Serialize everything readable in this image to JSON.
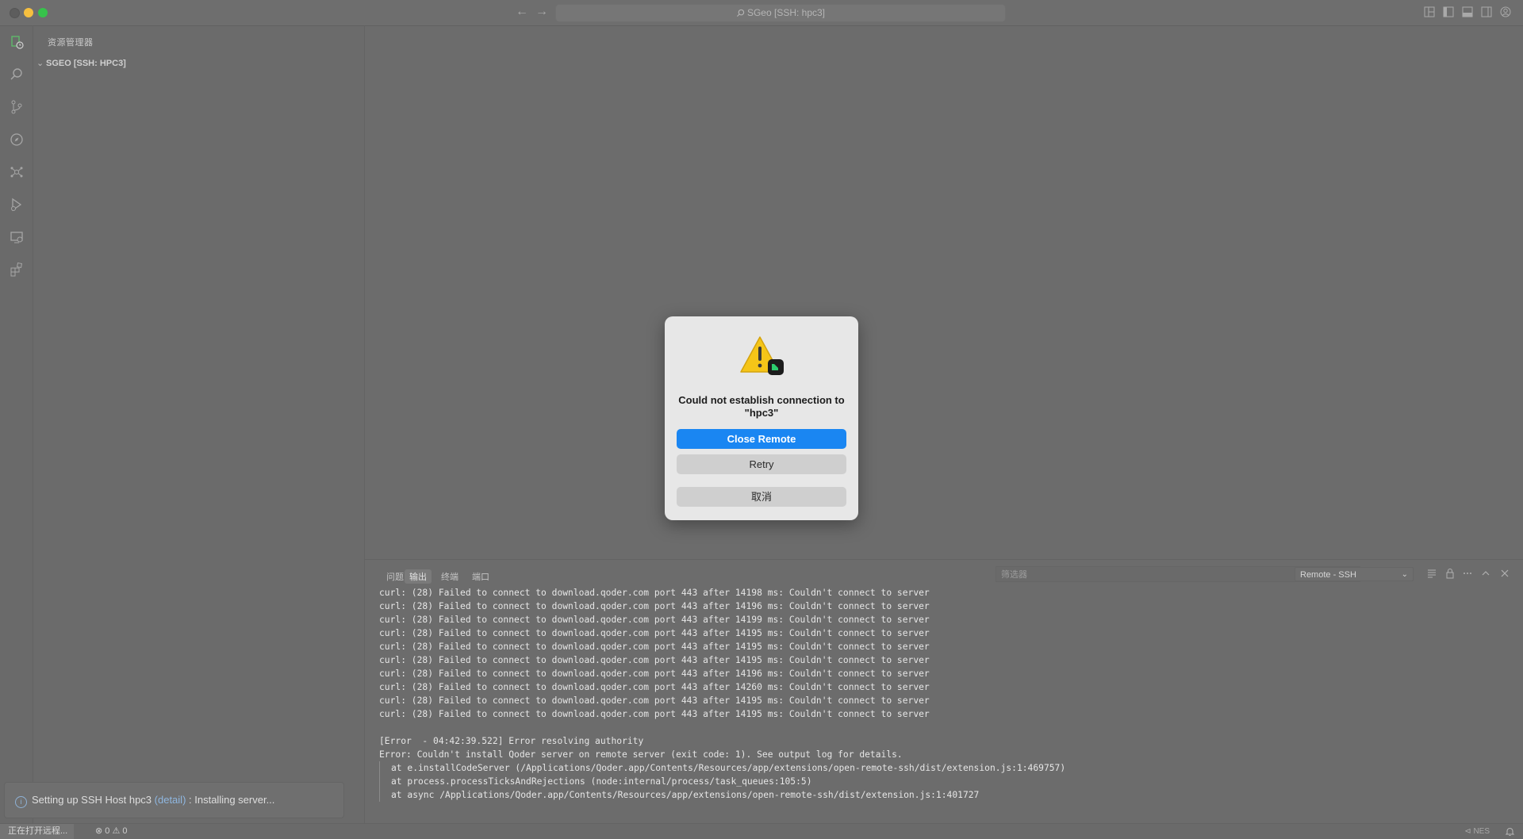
{
  "titlebar": {
    "title": "SGeo [SSH: hpc3]"
  },
  "sidebar": {
    "title": "资源管理器",
    "root_folder": "SGEO [SSH: HPC3]"
  },
  "notification": {
    "prefix": "Setting up SSH Host hpc3 ",
    "link": "(detail)",
    "suffix": " : Installing server..."
  },
  "panel": {
    "tabs": [
      "问题",
      "输出",
      "终端",
      "端口"
    ],
    "active_tab": "输出",
    "filter_placeholder": "筛选器",
    "channel": "Remote - SSH",
    "log_lines": [
      "curl: (28) Failed to connect to download.qoder.com port 443 after 14198 ms: Couldn't connect to server",
      "curl: (28) Failed to connect to download.qoder.com port 443 after 14196 ms: Couldn't connect to server",
      "curl: (28) Failed to connect to download.qoder.com port 443 after 14199 ms: Couldn't connect to server",
      "curl: (28) Failed to connect to download.qoder.com port 443 after 14195 ms: Couldn't connect to server",
      "curl: (28) Failed to connect to download.qoder.com port 443 after 14195 ms: Couldn't connect to server",
      "curl: (28) Failed to connect to download.qoder.com port 443 after 14195 ms: Couldn't connect to server",
      "curl: (28) Failed to connect to download.qoder.com port 443 after 14196 ms: Couldn't connect to server",
      "curl: (28) Failed to connect to download.qoder.com port 443 after 14260 ms: Couldn't connect to server",
      "curl: (28) Failed to connect to download.qoder.com port 443 after 14195 ms: Couldn't connect to server",
      "curl: (28) Failed to connect to download.qoder.com port 443 after 14195 ms: Couldn't connect to server"
    ],
    "error_header": "[Error  - 04:42:39.522] Error resolving authority",
    "error_message": "Error: Couldn't install Qoder server on remote server (exit code: 1). See output log for details.",
    "stack": [
      "at e.installCodeServer (/Applications/Qoder.app/Contents/Resources/app/extensions/open-remote-ssh/dist/extension.js:1:469757)",
      "at process.processTicksAndRejections (node:internal/process/task_queues:105:5)",
      "at async /Applications/Qoder.app/Contents/Resources/app/extensions/open-remote-ssh/dist/extension.js:1:401727"
    ]
  },
  "statusbar": {
    "remote": "正在打开远程...",
    "errors": "0",
    "warnings": "0",
    "right_text": "NES"
  },
  "dialog": {
    "title": "Could not establish connection to \"hpc3\"",
    "primary": "Close Remote",
    "secondary": "Retry",
    "cancel": "取消"
  },
  "colors": {
    "accent_blue": "#1a86f2",
    "warning_yellow": "#f5c518",
    "traffic_min": "#f6bf3f",
    "traffic_max": "#37c24b"
  }
}
